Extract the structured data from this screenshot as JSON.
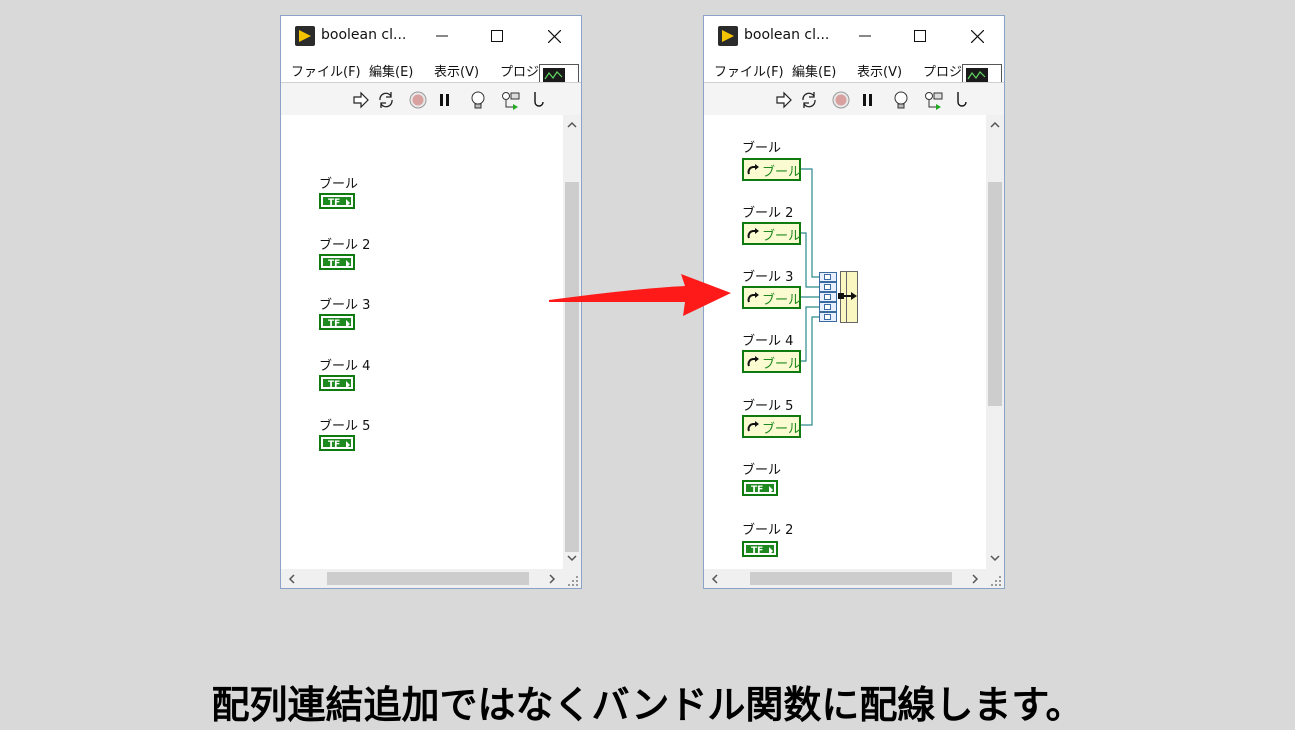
{
  "windows": [
    {
      "title": "boolean cl...",
      "menu": [
        "ファイル(F)",
        "編集(E)",
        "表示(V)",
        "プロジ"
      ],
      "connector_number": "2",
      "controls": [
        "ブール",
        "ブール 2",
        "ブール 3",
        "ブール 4",
        "ブール 5"
      ]
    },
    {
      "title": "boolean cl...",
      "menu": [
        "ファイル(F)",
        "編集(E)",
        "表示(V)",
        "プロジ"
      ],
      "connector_number": "2",
      "local_variables": [
        "ブール",
        "ブール 2",
        "ブール 3",
        "ブール 4",
        "ブール 5"
      ],
      "local_variable_caption": "ブール",
      "controls": [
        "ブール",
        "ブール 2"
      ]
    }
  ],
  "caption": "配列連結追加ではなくバンドル関数に配線します。",
  "colors": {
    "arrow": "#ff1a1a",
    "boolean_green": "#1f8a1f",
    "wire": "#2a8a8a",
    "bundle_fill": "#fbf7c0"
  },
  "icons": [
    "labview-vi-icon",
    "minimize-icon",
    "maximize-icon",
    "close-icon",
    "run-arrow-icon",
    "run-continuous-icon",
    "abort-icon",
    "pause-icon",
    "highlight-bulb-icon",
    "probe-icon",
    "reference-icon",
    "bundle-icon"
  ]
}
